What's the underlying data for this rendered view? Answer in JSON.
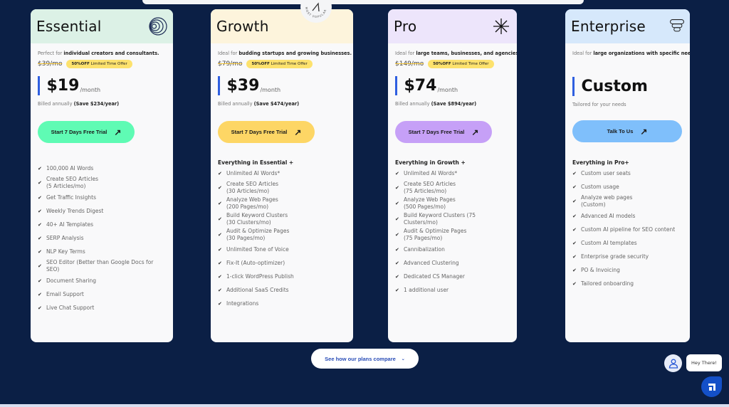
{
  "colors": {
    "page_bg": "#0b1f45",
    "essential_head": "#dcf1e6",
    "growth_head": "#fdf4dc",
    "pro_head": "#ede5fb",
    "enterprise_head": "#d6e8fb",
    "essential_cta": "#5ffbb4",
    "growth_cta": "#fdd665",
    "pro_cta": "#c6a0f7",
    "enterprise_cta": "#7fbffb",
    "accent_bar": "#2f5fe0",
    "offer_badge": "#fde26d"
  },
  "popular_badge": {
    "label": "MOST POPULAR",
    "icon": "arrow-up-right-icon"
  },
  "plans": [
    {
      "name": "Essential",
      "icon": "concentric-circles-icon",
      "tagline_prefix": "Perfect for ",
      "tagline_bold": "individual creators and consultants.",
      "old_price": "$39/mo",
      "offer_bold": "50%OFF",
      "offer_text": " Limited Time Offer",
      "price": "$19",
      "price_unit": "/month",
      "billed_prefix": "Billed annually ",
      "billed_bold": "(Save $234/year)",
      "cta": "Start 7 Days Free Trial",
      "features_title": "",
      "features": [
        "100,000 AI Words",
        "Create SEO Articles\n(5 Articles/mo)",
        "Get Traffic Insights",
        "Weekly Trends Digest",
        "40+ AI Templates",
        "SERP Analysis",
        "NLP Key Terms",
        "SEO Editor (Better than Google Docs for SEO)",
        "Document Sharing",
        "Email Support",
        "Live Chat Support"
      ]
    },
    {
      "name": "Growth",
      "icon": "none",
      "tagline_prefix": "Ideal for ",
      "tagline_bold": "budding startups and growing businesses.",
      "old_price": "$79/mo",
      "offer_bold": "50%OFF",
      "offer_text": " Limited Time Offer",
      "price": "$39",
      "price_unit": "/month",
      "billed_prefix": "Billed annually ",
      "billed_bold": "(Save $474/year)",
      "cta": "Start 7 Days Free Trial",
      "features_title": "Everything in Essential +",
      "features": [
        "Unlimited AI Words*",
        "Create SEO Articles\n(30 Articles/mo)",
        "Analyze Web Pages\n(200 Pages/mo)",
        "Build Keyword Clusters\n(30 Clusters/mo)",
        "Audit & Optimize Pages\n(30 Pages/mo)",
        "Unlimited Tone of Voice",
        "Fix-It (Auto-optimizer)",
        "1-click WordPress Publish",
        "Additional SaaS Credits",
        "Integrations"
      ]
    },
    {
      "name": "Pro",
      "icon": "asterisk-icon",
      "tagline_prefix": "Ideal for ",
      "tagline_bold": "large teams, businesses, and agencies",
      "old_price": "$149/mo",
      "offer_bold": "50%OFF",
      "offer_text": " Limited Time Offer",
      "price": "$74",
      "price_unit": "/month",
      "billed_prefix": "Billed annually ",
      "billed_bold": "(Save $894/year)",
      "cta": "Start 7 Days Free Trial",
      "features_title": "Everything in Growth +",
      "features": [
        "Unlimited AI Words*",
        "Create SEO Articles\n(75 Articles/mo)",
        "Analyze Web Pages\n(500 Pages/mo)",
        "Build Keyword Clusters (75 Clusters/mo)",
        "Audit & Optimize Pages\n(75 Pages/mo)",
        "Cannibalization",
        "Advanced Clustering",
        "Dedicated CS Manager",
        "1 additional user"
      ]
    },
    {
      "name": "Enterprise",
      "icon": "stacked-layers-icon",
      "tagline_prefix": "Ideal for ",
      "tagline_bold": "large organizations with specific needs",
      "price": "Custom",
      "sub": "Tailored for your needs",
      "cta": "Talk To Us",
      "features_title": "Everything in Pro+",
      "features": [
        "Custom user seats",
        "Custom usage",
        "Analyze web pages\n(Custom)",
        "Advanced AI models",
        "Custom AI pipeline for SEO content",
        "Custom AI templates",
        "Enterprise grade security",
        "PO & Invoicing",
        "Tailored onboarding"
      ]
    }
  ],
  "compare": {
    "label": "See how our plans compare",
    "icon": "chevron-down-icon"
  },
  "chat": {
    "greeting": "Hey There!",
    "avatar_icon": "user-icon",
    "launcher_icon": "chat-launcher-icon"
  }
}
